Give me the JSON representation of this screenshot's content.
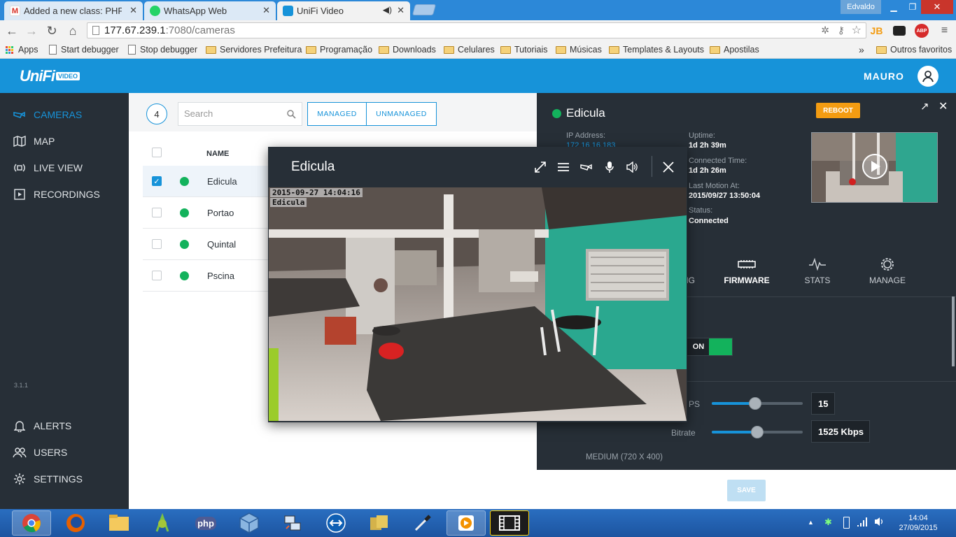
{
  "browser": {
    "tabs": [
      {
        "label": "Added a new class: PHP M",
        "icon": "gmail-icon"
      },
      {
        "label": "WhatsApp Web",
        "icon": "whatsapp-icon"
      },
      {
        "label": "UniFi Video",
        "icon": "unifi-icon",
        "active": true
      }
    ],
    "window_user": "Edvaldo",
    "url_host": "177.67.239.1",
    "url_rest": ":7080/cameras",
    "bookmarks": [
      "Apps",
      "Start debugger",
      "Stop debugger",
      "Servidores Prefeitura",
      "Programação",
      "Downloads",
      "Celulares",
      "Tutoriais",
      "Músicas",
      "Templates & Layouts",
      "Apostilas"
    ],
    "bookmarks_more": "»",
    "other_bookmarks": "Outros favoritos",
    "ext_abp": "ABP",
    "ext_jb": "JB"
  },
  "header": {
    "logo": "UniFi",
    "logo_badge": "VIDEO",
    "user": "MAURO"
  },
  "sidebar": {
    "items": [
      {
        "label": "CAMERAS",
        "icon": "camera-icon",
        "active": true
      },
      {
        "label": "MAP",
        "icon": "map-icon"
      },
      {
        "label": "LIVE VIEW",
        "icon": "live-view-icon"
      },
      {
        "label": "RECORDINGS",
        "icon": "recordings-icon"
      }
    ],
    "version": "3.1.1",
    "bottom_items": [
      {
        "label": "ALERTS",
        "icon": "bell-icon"
      },
      {
        "label": "USERS",
        "icon": "users-icon"
      },
      {
        "label": "SETTINGS",
        "icon": "gear-icon"
      }
    ]
  },
  "list": {
    "count": "4",
    "search_placeholder": "Search",
    "filter_managed": "MANAGED",
    "filter_unmanaged": "UNMANAGED",
    "col_name": "NAME",
    "cameras": [
      {
        "name": "Edicula",
        "selected": true,
        "status": "online"
      },
      {
        "name": "Portao",
        "selected": false,
        "status": "online"
      },
      {
        "name": "Quintal",
        "selected": false,
        "status": "online"
      },
      {
        "name": "Pscina",
        "selected": false,
        "status": "online"
      }
    ]
  },
  "details": {
    "title": "Edicula",
    "reboot": "REBOOT",
    "ip_label": "IP Address:",
    "ip_value": "172.16.16.183",
    "uptime_label": "Uptime:",
    "uptime_value": "1d 2h 39m",
    "connected_label": "Connected Time:",
    "connected_value": "1d 2h 26m",
    "motion_label": "Last Motion At:",
    "motion_value": "2015/09/27 13:50:04",
    "status_label": "Status:",
    "status_value": "Connected",
    "tabs": {
      "partial": "NG",
      "firmware": "FIRMWARE",
      "stats": "STATS",
      "manage": "MANAGE"
    },
    "toggle_on": "ON",
    "fps_label_partial": "PS",
    "fps_value": "15",
    "fps_fraction": 0.48,
    "bitrate_label": "Bitrate",
    "bitrate_value": "1525 Kbps",
    "bitrate_fraction": 0.5,
    "resolution": "MEDIUM (720 X 400)",
    "save": "SAVE"
  },
  "video_popup": {
    "title": "Edicula",
    "osd_time": "2015-09-27 14:04:16",
    "osd_name": "Edicula"
  },
  "taskbar": {
    "apps": [
      "chrome-icon",
      "firefox-icon",
      "explorer-icon",
      "android-studio-icon",
      "php-icon",
      "virtualbox-icon",
      "network-icon",
      "teamviewer-icon",
      "files-icon",
      "eyedropper-icon",
      "media-player-icon",
      "video-film-icon"
    ],
    "time": "14:04",
    "date": "27/09/2015"
  },
  "colors": {
    "accent": "#1793d9",
    "sidebar": "#272f37",
    "online": "#13b25c",
    "reboot": "#f39c12"
  }
}
